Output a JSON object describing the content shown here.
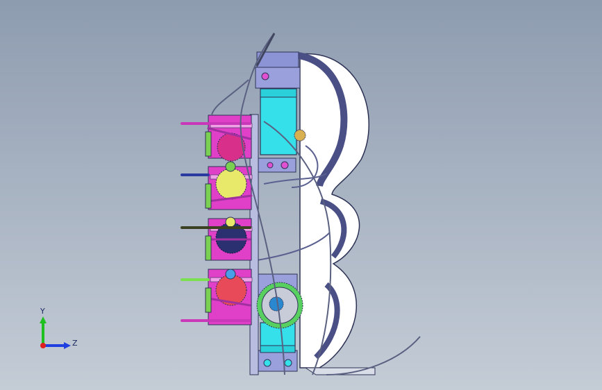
{
  "viewport": {
    "background_top": "#8e9cb0",
    "background_bottom": "#c4ccd6"
  },
  "triad": {
    "y_label": "Y",
    "z_label": "Z",
    "y_color": "#1fc01f",
    "z_color": "#1f3fe0",
    "x_color": "#e01f1f"
  },
  "model": {
    "frame_color": "#7b85c9",
    "motor_color": "#35e0ea",
    "board_color": "#e040c8",
    "shell_color": "#ffffff",
    "shell_edge_color": "#3a3f6a"
  }
}
